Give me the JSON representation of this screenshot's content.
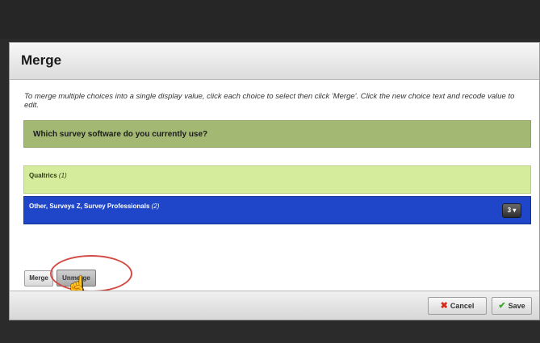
{
  "dialog": {
    "title": "Merge",
    "instructions": "To merge multiple choices into a single display value, click each choice to select then click 'Merge'. Click the new choice text and recode value to edit."
  },
  "question": {
    "text": "Which survey software do you currently use?"
  },
  "choices": [
    {
      "label": "Qualtrics",
      "count": "(1)",
      "color": "#d5ec9c"
    },
    {
      "label": "Other, Surveys Z, Survey Professionals",
      "count": "(2)",
      "color": "#1f45c8",
      "recode_value": "3"
    }
  ],
  "actions": {
    "merge_label": "Merge",
    "unmerge_label": "Unmerge"
  },
  "footer": {
    "cancel_label": "Cancel",
    "save_label": "Save"
  },
  "icons": {
    "cancel": "close-icon",
    "save": "checkmark-icon",
    "dropdown": "chevron-down-icon",
    "cursor": "hand-pointer-icon"
  },
  "colors": {
    "question_bar": "#a3b873",
    "highlight_ring": "#d44b45"
  }
}
